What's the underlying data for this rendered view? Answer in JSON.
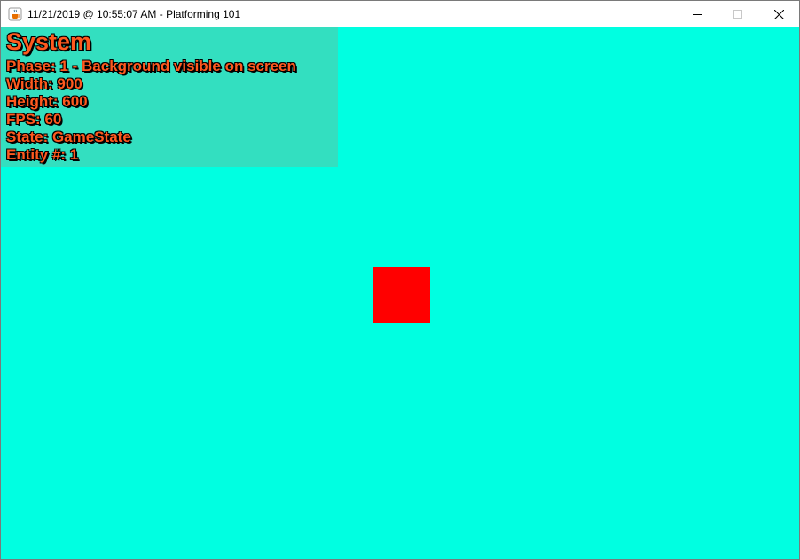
{
  "window": {
    "title": "11/21/2019 @ 10:55:07 AM - Platforming 101",
    "icon": "java-cup-icon"
  },
  "colors": {
    "background": "#00ffe1",
    "debug_panel_bg": "#33dfc0",
    "debug_text": "#ff5a1f",
    "debug_text_outline": "#000000",
    "entity": "#ff0000"
  },
  "debug": {
    "title": "System",
    "lines": [
      "Phase: 1 - Background visible on screen",
      "Width: 900",
      "Height: 600",
      "FPS: 60",
      "State: GameState",
      "Entity #: 1"
    ]
  }
}
